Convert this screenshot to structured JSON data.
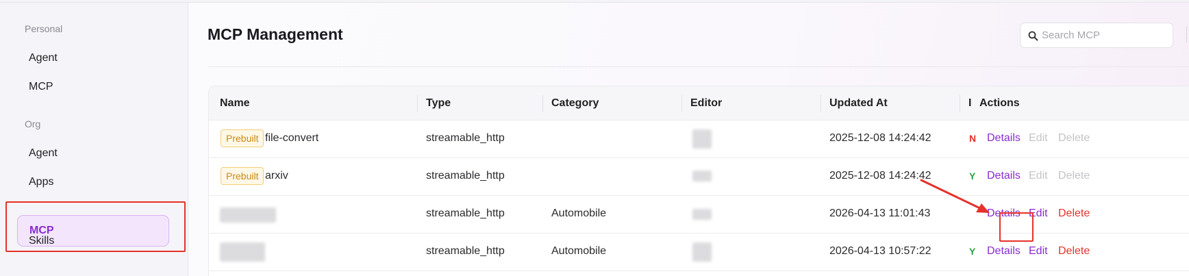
{
  "sidebar": {
    "personal_label": "Personal",
    "personal_items": [
      {
        "label": "Agent"
      },
      {
        "label": "MCP"
      }
    ],
    "org_label": "Org",
    "org_items": [
      {
        "label": "Agent"
      },
      {
        "label": "Apps"
      },
      {
        "label": "MCP"
      },
      {
        "label": "Skills"
      }
    ]
  },
  "header": {
    "title": "MCP Management",
    "search_placeholder": "Search MCP"
  },
  "table": {
    "columns": [
      "Name",
      "Type",
      "Category",
      "Editor",
      "Updated At",
      "I",
      "Actions"
    ],
    "action_labels": {
      "details": "Details",
      "edit": "Edit",
      "delete": "Delete"
    },
    "rows": [
      {
        "badge": "Prebuilt",
        "name": "file-convert",
        "type": "streamable_http",
        "category": "",
        "updated_at": "2025-12-08 14:24:42",
        "status_fragment": "N",
        "status_color": "#e5312a",
        "edit_enabled": false,
        "delete_enabled": false
      },
      {
        "badge": "Prebuilt",
        "name": "arxiv",
        "type": "streamable_http",
        "category": "",
        "updated_at": "2025-12-08 14:24:42",
        "status_fragment": "Y",
        "status_color": "#2ea043",
        "edit_enabled": false,
        "delete_enabled": false
      },
      {
        "badge": "",
        "name": "",
        "type": "streamable_http",
        "category": "Automobile",
        "updated_at": "2026-04-13 11:01:43",
        "status_fragment": "",
        "status_color": "#e5312a",
        "edit_enabled": true,
        "delete_enabled": true
      },
      {
        "badge": "",
        "name": "",
        "type": "streamable_http",
        "category": "Automobile",
        "updated_at": "2026-04-13 10:57:22",
        "status_fragment": "Y",
        "status_color": "#2ea043",
        "edit_enabled": true,
        "delete_enabled": true
      }
    ]
  },
  "colors": {
    "accent": "#8a2bd0",
    "danger": "#e5312a",
    "highlight_box": "#e5312a",
    "prebuilt_badge": "#c98a12"
  },
  "icons": {
    "search": "search-icon"
  }
}
